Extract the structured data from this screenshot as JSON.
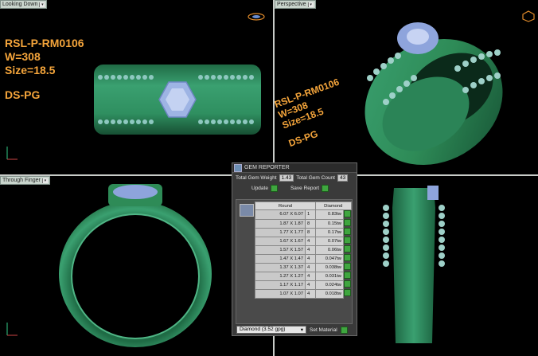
{
  "viewports": {
    "top_left": {
      "label": "Looking Down"
    },
    "top_right": {
      "label": "Perspective"
    },
    "bottom_left": {
      "label": "Through Finger"
    }
  },
  "ring_info": {
    "sku": "RSL-P-RM0106",
    "weight": "W=308",
    "size": "Size=18.5",
    "metal": "DS-PG"
  },
  "gem_reporter": {
    "title": "GEM REPORTER",
    "total_weight_label": "Total Gem Weight",
    "total_weight": "1.43",
    "total_count_label": "Total Gem Count",
    "total_count": "43",
    "update_label": "Update",
    "save_report_label": "Save Report",
    "col_shape": "Round",
    "col_stone": "Diamond",
    "rows": [
      {
        "size": "6.07 X 6.07",
        "qty": "1",
        "ct": "0.83tw"
      },
      {
        "size": "1.87 X 1.87",
        "qty": "8",
        "ct": "0.15tw"
      },
      {
        "size": "1.77 X 1.77",
        "qty": "8",
        "ct": "0.17tw"
      },
      {
        "size": "1.67 X 1.67",
        "qty": "4",
        "ct": "0.07tw"
      },
      {
        "size": "1.57 X 1.57",
        "qty": "4",
        "ct": "0.06tw"
      },
      {
        "size": "1.47 X 1.47",
        "qty": "4",
        "ct": "0.047tw"
      },
      {
        "size": "1.37 X 1.37",
        "qty": "4",
        "ct": "0.038tw"
      },
      {
        "size": "1.27 X 1.27",
        "qty": "4",
        "ct": "0.031tw"
      },
      {
        "size": "1.17 X 1.17",
        "qty": "4",
        "ct": "0.024tw"
      },
      {
        "size": "1.07 X 1.07",
        "qty": "4",
        "ct": "0.018tw"
      }
    ],
    "material_select": "Diamond",
    "material_sg": "(3.52 gpg)",
    "set_material_label": "Set Material"
  },
  "colors": {
    "ring_green": "#2e8b57",
    "gem_blue": "#8fa4d8",
    "label_orange": "#f5a53b"
  }
}
